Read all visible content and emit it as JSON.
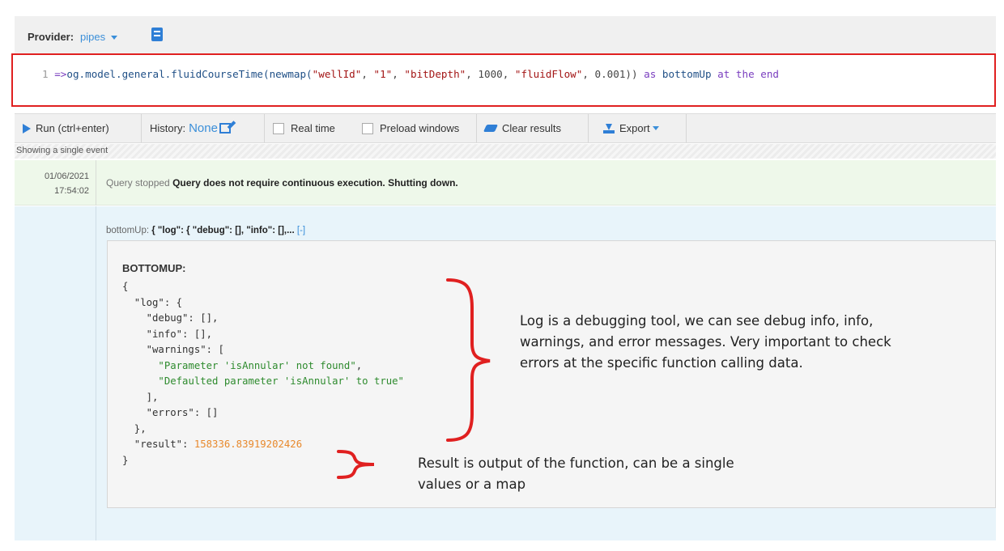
{
  "provider": {
    "label": "Provider:",
    "value": "pipes",
    "docs_icon": "book-icon"
  },
  "editor": {
    "line_number": "1",
    "prompt": "=>",
    "tokens": {
      "call": "og.model.general.fluidCourseTime(newmap(",
      "s1": "\"wellId\"",
      "c1": ", ",
      "s2": "\"1\"",
      "c2": ", ",
      "s3": "\"bitDepth\"",
      "c3": ", 1000, ",
      "s4": "\"fluidFlow\"",
      "c4": ", 0.001)) ",
      "kw1": "as",
      "alias": " bottomUp ",
      "kw2": "at the end"
    }
  },
  "toolbar": {
    "run_label": "Run",
    "run_shortcut": "(ctrl+enter)",
    "history_label": "History:",
    "history_value": "None",
    "realtime_label": "Real time",
    "preload_label": "Preload windows",
    "clear_label": "Clear results",
    "export_label": "Export"
  },
  "status": {
    "text": "Showing a single event"
  },
  "event": {
    "date": "01/06/2021",
    "time": "17:54:02",
    "prefix": "Query stopped",
    "message": "Query does not require continuous execution. Shutting down."
  },
  "result": {
    "summary_key": "bottomUp:",
    "summary_value": "{ \"log\": { \"debug\": [], \"info\": [],...",
    "collapse": "[-]",
    "panel_title": "BOTTOMUP:",
    "json_lines": {
      "l1": "{",
      "l2": "  \"log\": {",
      "l3": "    \"debug\": [],",
      "l4": "    \"info\": [],",
      "l5": "    \"warnings\": [",
      "l6": "\"Parameter 'isAnnular' not found\"",
      "l6_tail": ",",
      "l7": "\"Defaulted parameter 'isAnnular' to true\"",
      "l8": "    ],",
      "l9": "    \"errors\": []",
      "l10": "  },",
      "l11_key": "  \"result\": ",
      "l11_val": "158336.83919202426",
      "l12": "}"
    }
  },
  "annotations": {
    "log_note": "Log is a debugging tool, we can see debug info, info, warnings, and error messages. Very important to check errors at the specific function calling data.",
    "result_note": "Result is output of the function, can be a single values or a map"
  },
  "colors": {
    "accent": "#3b8fd9",
    "annotation_red": "#e02020",
    "event_bg": "#eef8ea",
    "result_bg": "#e8f4fa",
    "json_string": "#2e8b2e",
    "json_number": "#e8892c"
  }
}
